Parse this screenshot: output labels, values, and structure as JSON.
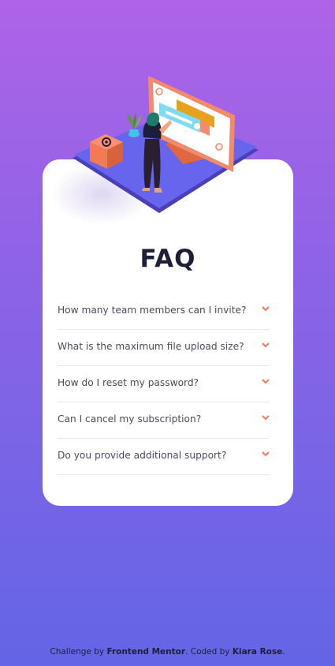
{
  "page": {
    "title": "FAQ"
  },
  "illustration": {
    "name": "woman-online-illustration"
  },
  "faq": {
    "items": [
      {
        "question": "How many team members can I invite?"
      },
      {
        "question": "What is the maximum file upload size?"
      },
      {
        "question": "How do I reset my password?"
      },
      {
        "question": "Can I cancel my subscription?"
      },
      {
        "question": "Do you provide additional support?"
      }
    ],
    "chevron_icon": "chevron-down-icon"
  },
  "footer": {
    "prefix": "Challenge by ",
    "challenge_by": "Frontend Mentor",
    "middle": ". Coded by ",
    "coded_by": "Kiara Rose",
    "suffix": "."
  },
  "colors": {
    "bg_top": "#ae63e8",
    "bg_bottom": "#6365e6",
    "title": "#1e1f36",
    "question": "#4a4b5e",
    "chevron": "#f47b56",
    "card": "#ffffff"
  }
}
